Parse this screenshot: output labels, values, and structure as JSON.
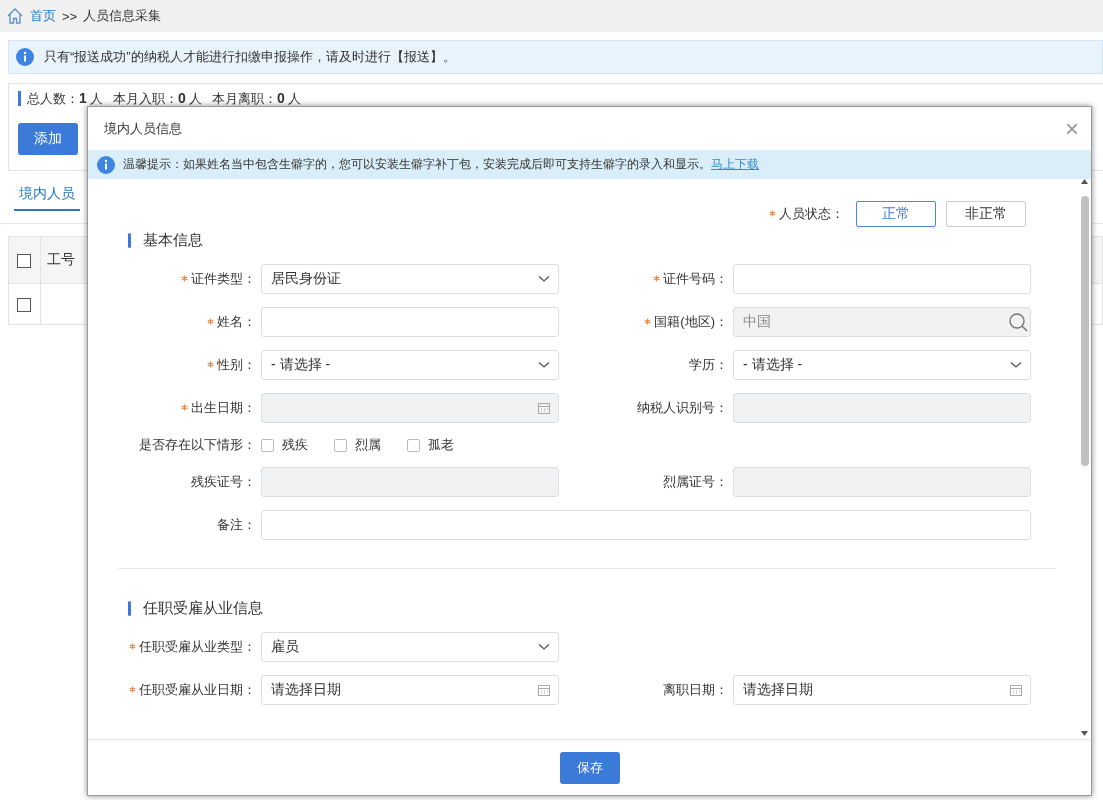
{
  "breadcrumb": {
    "home": "首页",
    "separator": ">>",
    "current": "人员信息采集"
  },
  "notice": "只有“报送成功”的纳税人才能进行扣缴申报操作，请及时进行【报送】。",
  "stats": [
    {
      "label": "总人数：",
      "value": "1",
      "unit": "人"
    },
    {
      "label": "本月入职：",
      "value": "0",
      "unit": "人"
    },
    {
      "label": "本月离职：",
      "value": "0",
      "unit": "人"
    }
  ],
  "add_button": "添加",
  "tabs": [
    {
      "label": "境内人员",
      "selected": true
    }
  ],
  "table": {
    "columns": [
      "工号"
    ],
    "rows": [
      {
        "checked": false
      }
    ],
    "header_checked": false
  },
  "dialog": {
    "title": "境内人员信息",
    "close": "×",
    "tip": "温馨提示：如果姓名当中包含生僻字的，您可以安装生僻字补丁包，安装完成后即可支持生僻字的录入和显示。",
    "tip_link": "马上下载",
    "status": {
      "label": "人员状态：",
      "required": true,
      "options": [
        {
          "label": "正常",
          "selected": true
        },
        {
          "label": "非正常",
          "selected": false
        }
      ]
    },
    "sections": [
      {
        "title": "基本信息",
        "rows": [
          [
            {
              "kind": "select",
              "label": "证件类型：",
              "required": true,
              "value": "居民身份证"
            },
            {
              "kind": "input",
              "label": "证件号码：",
              "required": true
            }
          ],
          [
            {
              "kind": "input",
              "label": "姓名：",
              "required": true
            },
            {
              "kind": "search",
              "label": "国籍(地区)：",
              "required": true,
              "value": "中国",
              "disabled": true
            }
          ],
          [
            {
              "kind": "select",
              "label": "性别：",
              "required": true,
              "value": "- 请选择 -"
            },
            {
              "kind": "select",
              "label": "学历：",
              "required": false,
              "value": "- 请选择 -"
            }
          ],
          [
            {
              "kind": "date",
              "label": "出生日期：",
              "required": true,
              "disabled": true
            },
            {
              "kind": "input",
              "label": "纳税人识别号：",
              "required": false,
              "disabled": true
            }
          ],
          [
            {
              "kind": "checks",
              "label": "是否存在以下情形：",
              "required": false,
              "options": [
                {
                  "label": "残疾",
                  "checked": false
                },
                {
                  "label": "烈属",
                  "checked": false
                },
                {
                  "label": "孤老",
                  "checked": false
                }
              ]
            }
          ],
          [
            {
              "kind": "input",
              "label": "残疾证号：",
              "required": false,
              "disabled": true
            },
            {
              "kind": "input",
              "label": "烈属证号：",
              "required": false,
              "disabled": true
            }
          ],
          [
            {
              "kind": "wide",
              "label": "备注：",
              "required": false
            }
          ]
        ]
      },
      {
        "title": "任职受雇从业信息",
        "rows": [
          [
            {
              "kind": "select",
              "label": "任职受雇从业类型：",
              "required": true,
              "value": "雇员"
            }
          ],
          [
            {
              "kind": "date",
              "label": "任职受雇从业日期：",
              "required": true,
              "placeholder": "请选择日期"
            },
            {
              "kind": "date",
              "label": "离职日期：",
              "required": false,
              "placeholder": "请选择日期"
            }
          ]
        ]
      }
    ],
    "save_button": "保存"
  }
}
